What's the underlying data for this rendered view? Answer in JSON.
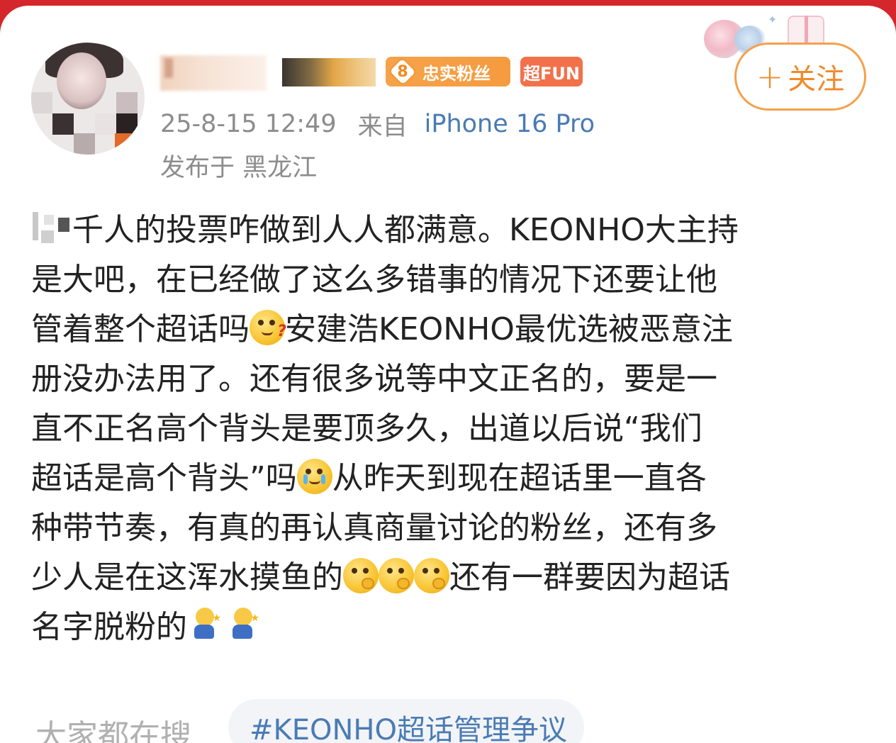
{
  "post": {
    "timestamp": "25-8-15 12:49",
    "source_prefix": "来自",
    "device": "iPhone 16 Pro",
    "location": "发布于 黑龙江",
    "badges": {
      "fan_level": "8",
      "fan_label": "忠实粉丝",
      "super_label": "超FUN"
    },
    "follow_label": "关注",
    "lines": [
      "千人的投票咋做到人人都满意。KEONHO大主持",
      "是大吧，在已经做了这么多错事的情况下还要让他",
      "管着整个超话吗",
      "安建浩KEONHO最优选被恶意注",
      "册没办法用了。还有很多说等中文正名的，要是一",
      "直不正名高个背头是要顶多久，出道以后说“我们",
      "超话是高个背头”吗",
      "从昨天到现在超话里一直各",
      "种带节奏，有真的再认真商量讨论的粉丝，还有多",
      "少人是在这浑水摸鱼的",
      "还有一群要因为超话",
      "名字脱粉的"
    ],
    "emojis": {
      "thinking": "thinking-face",
      "crying": "crying-face",
      "smirk": "smirk-face",
      "kneel": "kneel-figure"
    }
  },
  "search": {
    "label": "大家都在搜",
    "tag": "#KEONHO超话管理争议"
  }
}
